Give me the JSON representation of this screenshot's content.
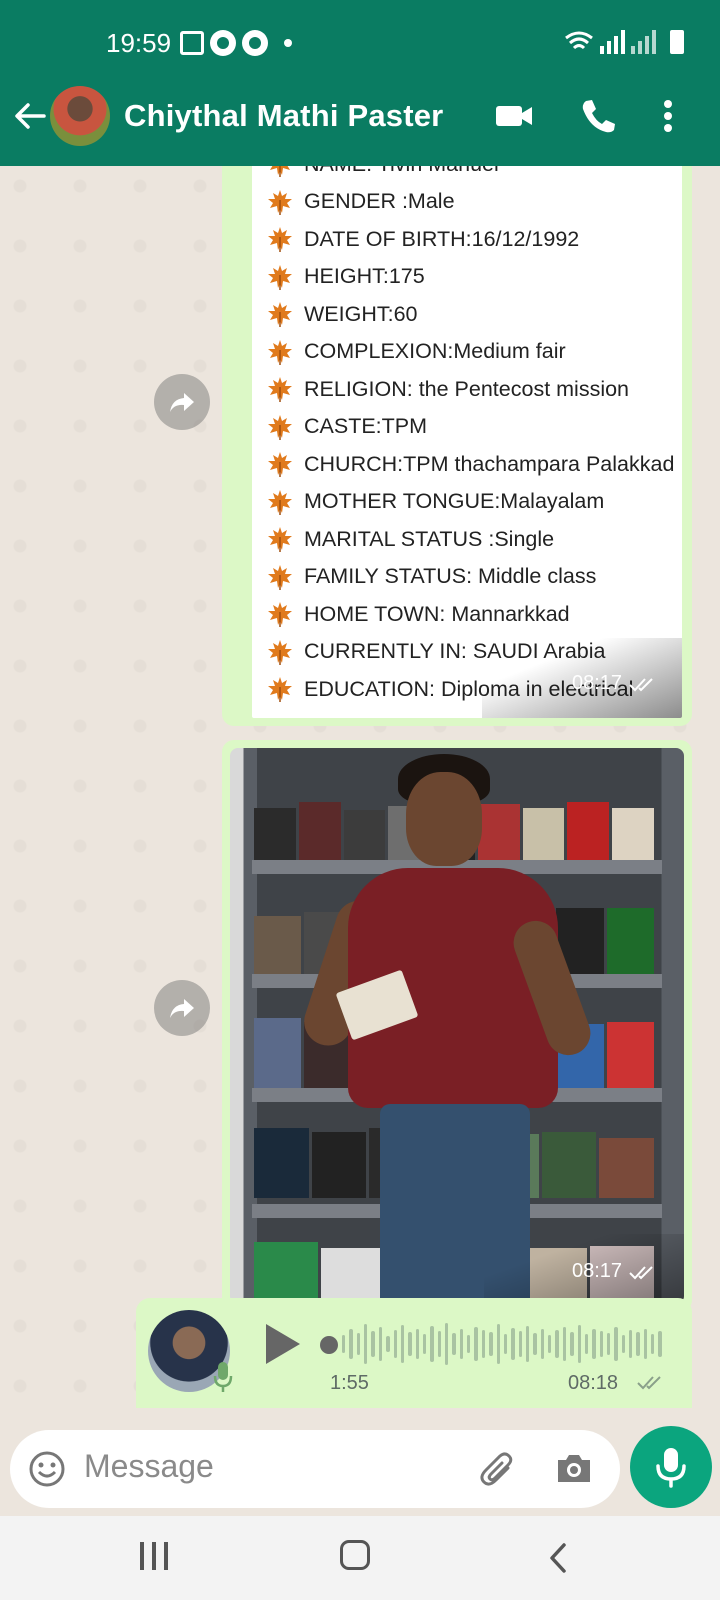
{
  "status": {
    "time": "19:59"
  },
  "header": {
    "contact_name": "Chiythal Mathi Paster",
    "icons": [
      "back-arrow-icon",
      "video-call-icon",
      "voice-call-icon",
      "more-options-icon"
    ]
  },
  "messages": {
    "biodata": {
      "lines": [
        "NAME: Tivin Manuel",
        "GENDER :Male",
        "DATE OF BIRTH:16/12/1992",
        "HEIGHT:175",
        "WEIGHT:60",
        "COMPLEXION:Medium fair",
        "RELIGION: the Pentecost mission",
        "CASTE:TPM",
        "CHURCH:TPM thachampara Palakkad",
        "MOTHER TONGUE:Malayalam",
        "MARITAL STATUS :Single",
        "FAMILY STATUS: Middle class",
        "HOME TOWN: Mannarkkad",
        "CURRENTLY IN: SAUDI Arabia",
        "EDUCATION: Diploma in electrical"
      ],
      "time": "08:17"
    },
    "photo": {
      "time": "08:17"
    },
    "voice": {
      "duration": "1:55",
      "time": "08:18"
    }
  },
  "input": {
    "placeholder": "Message"
  },
  "colors": {
    "header": "#0A7C62",
    "bubble": "#DCF8C6",
    "fab": "#0BA57E"
  }
}
